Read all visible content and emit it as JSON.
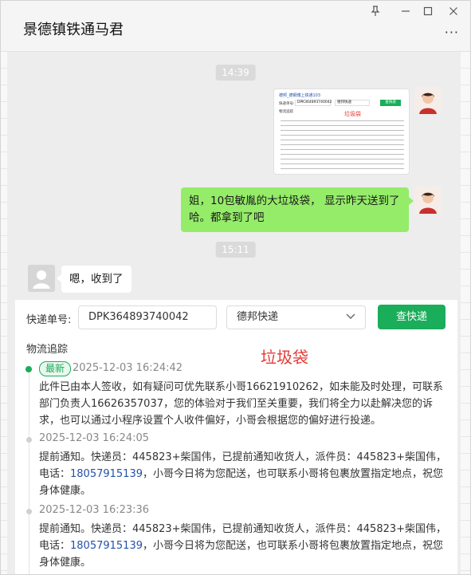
{
  "window": {
    "title": "景德镇铁通马君",
    "controls": [
      "pin-icon",
      "minimize-icon",
      "maximize-icon",
      "close-icon"
    ],
    "more_label": "···"
  },
  "messages": {
    "time1": "14:39",
    "thumbnail": {
      "title": "德邦_德钢博上铁通103",
      "tracking_label": "快递单号:",
      "tracking_no": "DPK364893740042",
      "courier": "德邦快递",
      "button": "查快递",
      "stamp": "垃圾袋",
      "section": "物流追踪"
    },
    "me_text": "姐，10包敏胤的大垃圾袋， 显示昨天送到了哈。都拿到了吧",
    "time2": "15:11",
    "other_text": "嗯，收到了"
  },
  "panel": {
    "tracking_label": "快递单号:",
    "tracking_number": "DPK364893740042",
    "courier": "德邦快递",
    "query_button": "查快递",
    "section_title": "物流追踪",
    "stamp": "垃圾袋",
    "entries": [
      {
        "badge": "最新",
        "time": "2025-12-03 16:24:42",
        "text": "此件已由本人签收，如有疑问可优先联系小哥16621910262，如未能及时处理，可联系部门负责人16626357037，您的体验对于我们至关重要，我们将全力以赴解决您的诉求，也可以通过小程序设置个人收件偏好，小哥会根据您的偏好进行投递。"
      },
      {
        "time": "2025-12-03 16:24:05",
        "text_a": "提前通知。快递员：445823+柴国伟，已提前通知收货人，派件员：445823+柴国伟，电话：",
        "phone": "18057915139",
        "text_b": "，小哥今日将为您配送，也可联系小哥将包裹放置指定地点，祝您身体健康。"
      },
      {
        "time": "2025-12-03 16:23:36",
        "text_a": "提前通知。快递员：445823+柴国伟，已提前通知收货人，派件员：445823+柴国伟，电话：",
        "phone": "18057915139",
        "text_b": "，小哥今日将为您配送，也可联系小哥将包裹放置指定地点，祝您身体健康。"
      }
    ]
  },
  "colors": {
    "bubble_me": "#95ec69",
    "accent_green": "#1aad5a",
    "stamp_red": "#e53935",
    "phone_blue": "#2450a8"
  }
}
